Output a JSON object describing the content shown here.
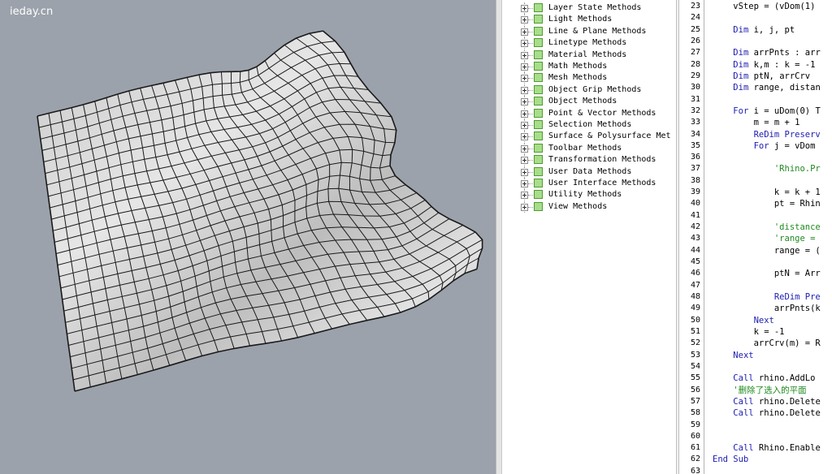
{
  "viewport": {
    "watermark": "ieday.cn",
    "background": "#9ba2ab",
    "surface_color": "#d8d8d8",
    "mesh_line_color": "#1a1a1a"
  },
  "tree": {
    "items": [
      "Layer State Methods",
      "Light Methods",
      "Line & Plane Methods",
      "Linetype Methods",
      "Material Methods",
      "Math Methods",
      "Mesh Methods",
      "Object Grip Methods",
      "Object Methods",
      "Point & Vector Methods",
      "Selection Methods",
      "Surface & Polysurface Met",
      "Toolbar Methods",
      "Transformation Methods",
      "User Data Methods",
      "User Interface Methods",
      "Utility Methods",
      "View Methods"
    ],
    "folder_color": "#a8de8a"
  },
  "editor": {
    "keyword_color": "#1c1cb0",
    "comment_color": "#1f8a1f",
    "lines": [
      {
        "num": "23",
        "segs": [
          [
            "    vStep = (vDom(1)",
            ""
          ]
        ]
      },
      {
        "num": "24",
        "segs": []
      },
      {
        "num": "25",
        "segs": [
          [
            "    ",
            ""
          ],
          [
            "Dim",
            "kw"
          ],
          [
            " i, j, pt",
            ""
          ]
        ]
      },
      {
        "num": "26",
        "segs": []
      },
      {
        "num": "27",
        "segs": [
          [
            "    ",
            ""
          ],
          [
            "Dim",
            "kw"
          ],
          [
            " arrPnts : arr",
            ""
          ]
        ]
      },
      {
        "num": "28",
        "segs": [
          [
            "    ",
            ""
          ],
          [
            "Dim",
            "kw"
          ],
          [
            " k,m : k = -1",
            ""
          ]
        ]
      },
      {
        "num": "29",
        "segs": [
          [
            "    ",
            ""
          ],
          [
            "Dim",
            "kw"
          ],
          [
            " ptN, arrCrv",
            ""
          ]
        ]
      },
      {
        "num": "30",
        "segs": [
          [
            "    ",
            ""
          ],
          [
            "Dim",
            "kw"
          ],
          [
            " range, distan",
            ""
          ]
        ]
      },
      {
        "num": "31",
        "segs": []
      },
      {
        "num": "32",
        "segs": [
          [
            "    ",
            ""
          ],
          [
            "For",
            "kw"
          ],
          [
            " i = uDom(0) T",
            ""
          ]
        ]
      },
      {
        "num": "33",
        "segs": [
          [
            "        m = m + 1",
            ""
          ]
        ]
      },
      {
        "num": "34",
        "segs": [
          [
            "        ",
            ""
          ],
          [
            "ReDim Preserv",
            "kw"
          ]
        ]
      },
      {
        "num": "35",
        "segs": [
          [
            "        ",
            ""
          ],
          [
            "For",
            "kw"
          ],
          [
            " j = vDom",
            ""
          ]
        ]
      },
      {
        "num": "36",
        "segs": []
      },
      {
        "num": "37",
        "segs": [
          [
            "            ",
            ""
          ],
          [
            "'Rhino.Pr",
            "cm"
          ]
        ]
      },
      {
        "num": "38",
        "segs": []
      },
      {
        "num": "39",
        "segs": [
          [
            "            k = k + 1",
            ""
          ]
        ]
      },
      {
        "num": "40",
        "segs": [
          [
            "            pt = Rhin",
            ""
          ]
        ]
      },
      {
        "num": "41",
        "segs": []
      },
      {
        "num": "42",
        "segs": [
          [
            "            ",
            ""
          ],
          [
            "'distance",
            "cm"
          ]
        ]
      },
      {
        "num": "43",
        "segs": [
          [
            "            ",
            ""
          ],
          [
            "'range =",
            "cm"
          ]
        ]
      },
      {
        "num": "44",
        "segs": [
          [
            "            range = (",
            ""
          ]
        ]
      },
      {
        "num": "45",
        "segs": []
      },
      {
        "num": "46",
        "segs": [
          [
            "            ptN = Arr",
            ""
          ]
        ]
      },
      {
        "num": "47",
        "segs": []
      },
      {
        "num": "48",
        "segs": [
          [
            "            ",
            ""
          ],
          [
            "ReDim Pre",
            "kw"
          ]
        ]
      },
      {
        "num": "49",
        "segs": [
          [
            "            arrPnts(k",
            ""
          ]
        ]
      },
      {
        "num": "50",
        "segs": [
          [
            "        ",
            ""
          ],
          [
            "Next",
            "kw"
          ]
        ]
      },
      {
        "num": "51",
        "segs": [
          [
            "        k = -1",
            ""
          ]
        ]
      },
      {
        "num": "52",
        "segs": [
          [
            "        arrCrv(m) = R",
            ""
          ]
        ]
      },
      {
        "num": "53",
        "segs": [
          [
            "    ",
            ""
          ],
          [
            "Next",
            "kw"
          ]
        ]
      },
      {
        "num": "54",
        "segs": []
      },
      {
        "num": "55",
        "segs": [
          [
            "    ",
            ""
          ],
          [
            "Call",
            "kw"
          ],
          [
            " rhino.AddLo",
            ""
          ]
        ]
      },
      {
        "num": "56",
        "segs": [
          [
            "    ",
            ""
          ],
          [
            "'删除了选入的平面",
            "cm"
          ]
        ]
      },
      {
        "num": "57",
        "segs": [
          [
            "    ",
            ""
          ],
          [
            "Call",
            "kw"
          ],
          [
            " rhino.Delete",
            ""
          ]
        ]
      },
      {
        "num": "58",
        "segs": [
          [
            "    ",
            ""
          ],
          [
            "Call",
            "kw"
          ],
          [
            " rhino.Delete",
            ""
          ]
        ]
      },
      {
        "num": "59",
        "segs": []
      },
      {
        "num": "60",
        "segs": []
      },
      {
        "num": "61",
        "segs": [
          [
            "    ",
            ""
          ],
          [
            "Call",
            "kw"
          ],
          [
            " Rhino.Enable",
            ""
          ]
        ]
      },
      {
        "num": "62",
        "segs": [
          [
            "End Sub",
            "kw"
          ]
        ]
      },
      {
        "num": "63",
        "segs": []
      }
    ]
  }
}
